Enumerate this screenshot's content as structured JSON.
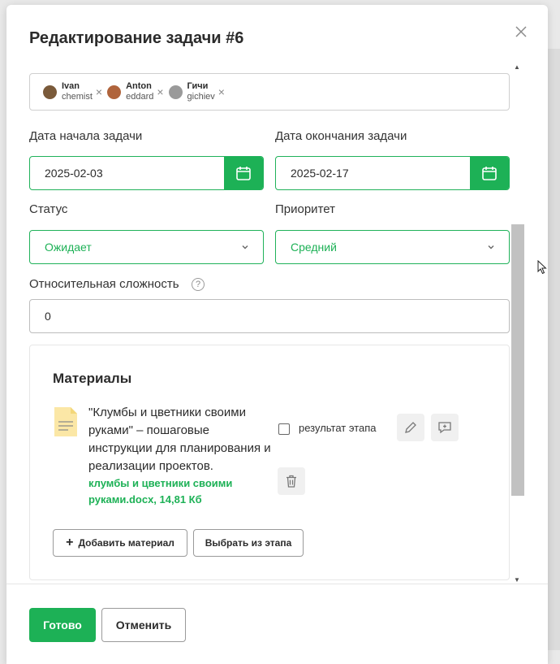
{
  "dialog": {
    "title": "Редактирование задачи #6"
  },
  "assignees": [
    {
      "name": "Ivan",
      "login": "chemist",
      "avatar_color": "#7a5a3a"
    },
    {
      "name": "Anton",
      "login": "eddard",
      "avatar_color": "#b0643c"
    },
    {
      "name": "Гичи",
      "login": "gichiev",
      "avatar_color": "#9a9a9a"
    }
  ],
  "dates": {
    "start_label": "Дата начала задачи",
    "start_value": "2025-02-03",
    "end_label": "Дата окончания задачи",
    "end_value": "2025-02-17"
  },
  "status": {
    "label": "Статус",
    "value": "Ожидает"
  },
  "priority": {
    "label": "Приоритет",
    "value": "Средний"
  },
  "complexity": {
    "label": "Относительная сложность",
    "help": "?",
    "value": "0"
  },
  "materials": {
    "title": "Материалы",
    "item": {
      "description": "\"Клумбы и цветники своими руками\" – пошаговые инструкции для планирования и реализации проектов.",
      "file": "клумбы и цветники своими руками.docx, 14,81 Кб",
      "checkbox_label": "результат этапа",
      "checked": false
    },
    "add_button": "Добавить материал",
    "add_icon": "+",
    "choose_button": "Выбрать из этапа"
  },
  "footer": {
    "done_button": "Готово",
    "cancel_button": "Отменить"
  },
  "colors": {
    "accent": "#1db156"
  }
}
